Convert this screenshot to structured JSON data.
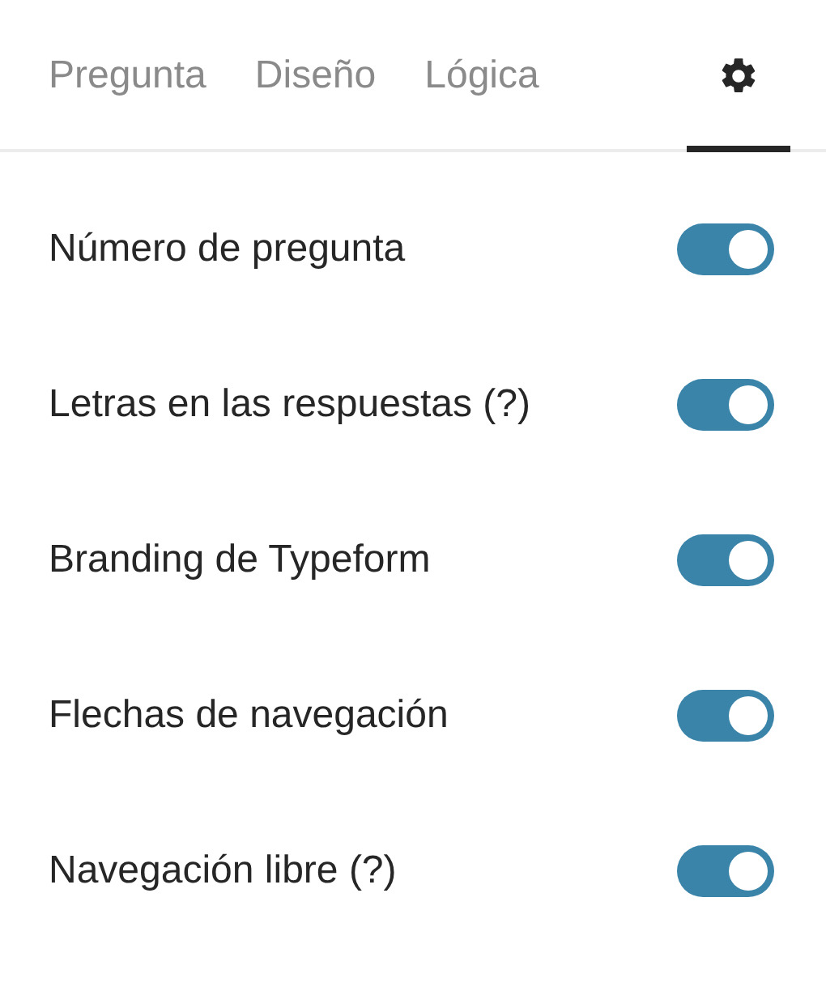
{
  "tabs": [
    {
      "kind": "text",
      "label": "Pregunta",
      "selected": false
    },
    {
      "kind": "text",
      "label": "Diseño",
      "selected": false
    },
    {
      "kind": "text",
      "label": "Lógica",
      "selected": false
    },
    {
      "kind": "icon",
      "selected": true
    }
  ],
  "settings": [
    {
      "label": "Número de pregunta",
      "on": true
    },
    {
      "label": "Letras en las respuestas (?)",
      "on": true
    },
    {
      "label": "Branding de Typeform",
      "on": true
    },
    {
      "label": "Flechas de navegación",
      "on": true
    },
    {
      "label": "Navegación libre (?)",
      "on": true
    }
  ]
}
